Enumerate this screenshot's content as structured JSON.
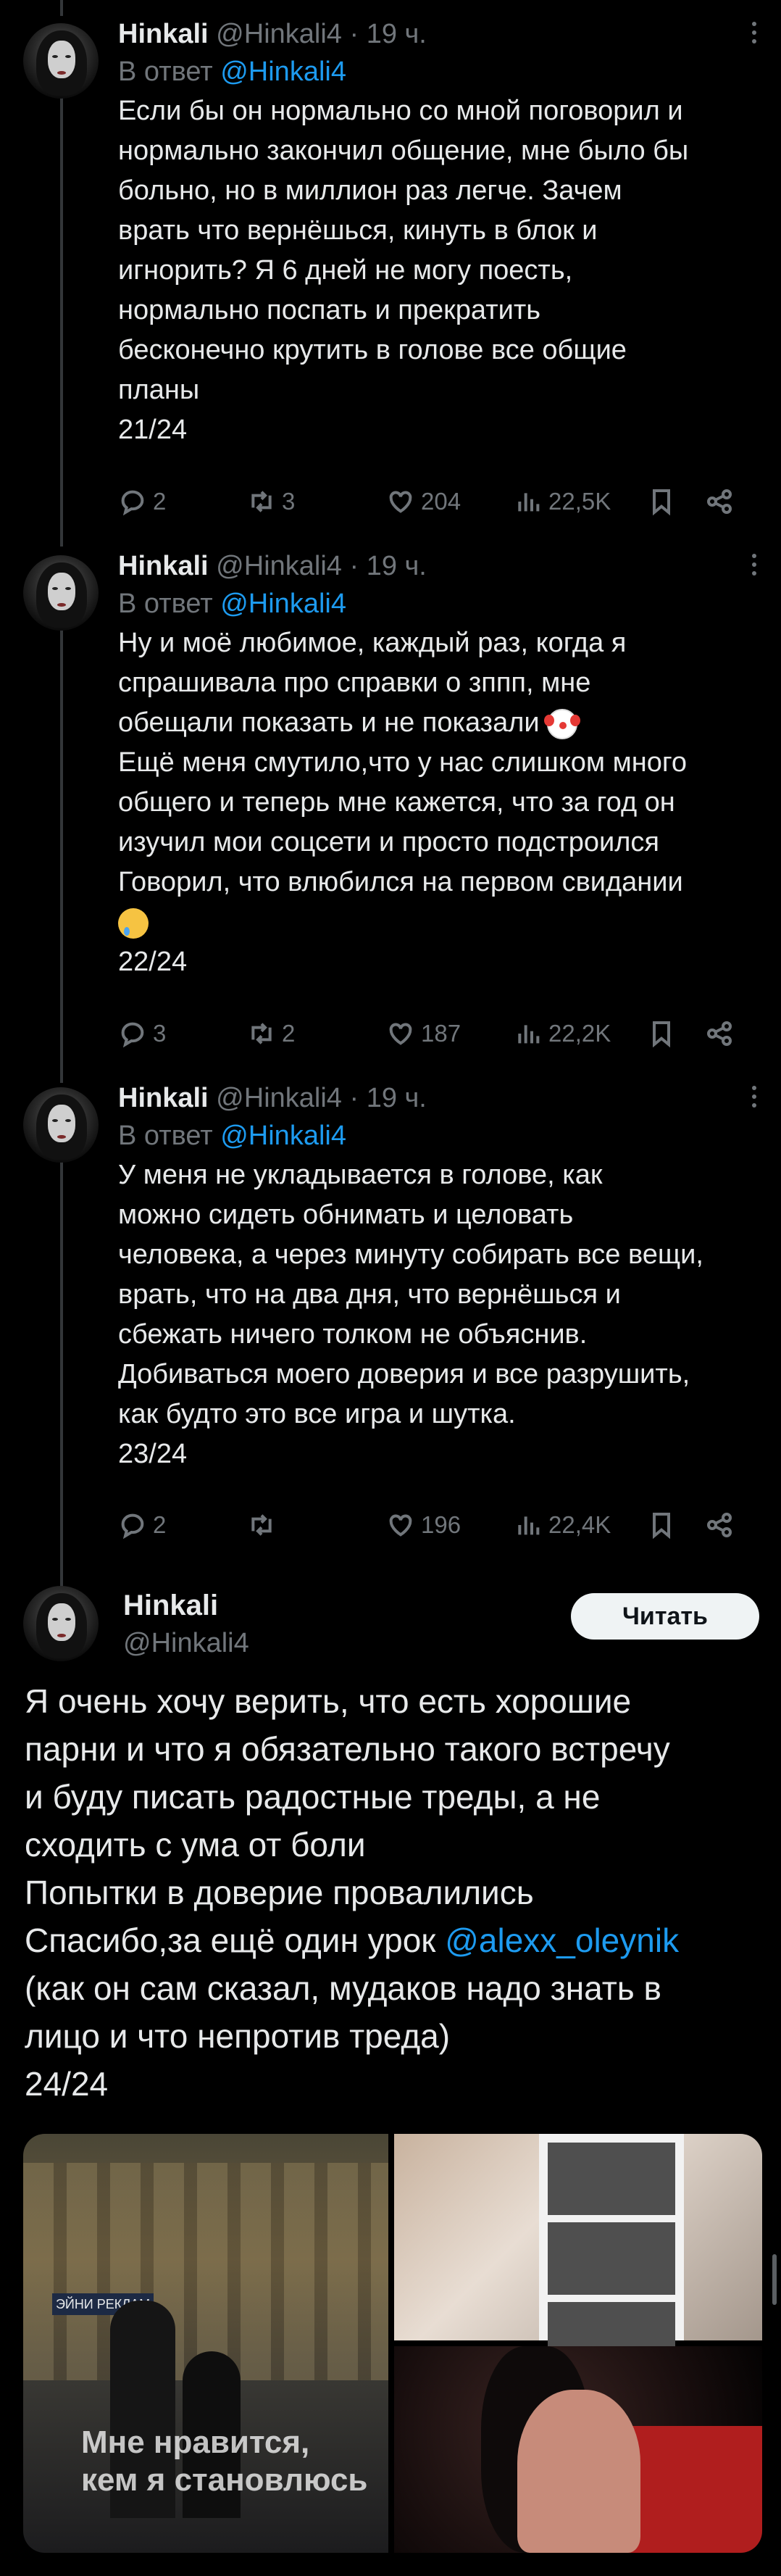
{
  "tweets": [
    {
      "name": "Hinkali",
      "handle": "@Hinkali4 · 19 ч.",
      "reply_prefix": "В ответ",
      "reply_handle": "@Hinkali4",
      "lines": [
        "Если бы он нормально со мной поговорил и",
        "нормально закончил общение, мне было бы",
        "больно, но в миллион раз легче. Зачем",
        "врать что вернёшься, кинуть в блок и",
        "игнорить? Я 6 дней не могу поесть,",
        "нормально поспать и прекратить",
        "бесконечно крутить  в голове все общие",
        "планы",
        "21/24"
      ],
      "replies": "2",
      "retweets": "3",
      "likes": "204",
      "views": "22,5K"
    },
    {
      "name": "Hinkali",
      "handle": "@Hinkali4 · 19 ч.",
      "reply_prefix": "В ответ",
      "reply_handle": "@Hinkali4",
      "lines": [
        "Ну и моё любимое, каждый раз, когда я",
        "спрашивала про справки о зппп, мне",
        "обещали показать и не показали",
        "Ещё меня смутило,что у нас слишком много",
        "общего и теперь мне кажется, что за год он",
        "изучил мои соцсети и просто подстроился",
        "Говорил, что влюбился на первом свидании",
        "",
        "22/24"
      ],
      "replies": "3",
      "retweets": "2",
      "likes": "187",
      "views": "22,2K"
    },
    {
      "name": "Hinkali",
      "handle": "@Hinkali4 · 19 ч.",
      "reply_prefix": "В ответ",
      "reply_handle": "@Hinkali4",
      "lines": [
        "У меня не укладывается в голове, как",
        "можно сидеть обнимать и целовать",
        "человека, а через минуту собирать все вещи,",
        "врать, что на два дня, что вернёшься и",
        "сбежать ничего толком не объяснив.",
        "Добиваться моего доверия и все разрушить,",
        "как будто это все игра и шутка.",
        "23/24"
      ],
      "replies": "2",
      "retweets": "",
      "likes": "196",
      "views": "22,4K"
    }
  ],
  "main_tweet": {
    "name": "Hinkali",
    "handle": "@Hinkali4",
    "follow_label": "Читать",
    "lines": [
      "Я очень хочу верить, что есть хорошие",
      "парни и что я обязательно такого встречу",
      "и буду писать радостные треды, а не",
      "сходить с ума от боли",
      "Попытки в доверие провалились"
    ],
    "thanks_text": "Спасибо,за ещё один урок ",
    "thanks_mention": "@alexx_oleynik",
    "tail_lines": [
      "(как он сам сказал, мудаков надо знать в",
      "лицо и что непротив треда)",
      "24/24"
    ],
    "media_caption_line1": "Мне нравится,",
    "media_caption_line2": "кем я становлюсь",
    "media_sign": "ЭЙНИ РЕКЛАМ"
  },
  "icons": {
    "reply": "comment-icon",
    "retweet": "retweet-icon",
    "like": "heart-icon",
    "views": "analytics-icon",
    "bookmark": "bookmark-icon",
    "share": "share-icon",
    "more": "more-dots-icon"
  },
  "colors": {
    "accent": "#1d9bf0",
    "muted": "#71767b",
    "text": "#e7e9ea",
    "background": "#000000"
  }
}
